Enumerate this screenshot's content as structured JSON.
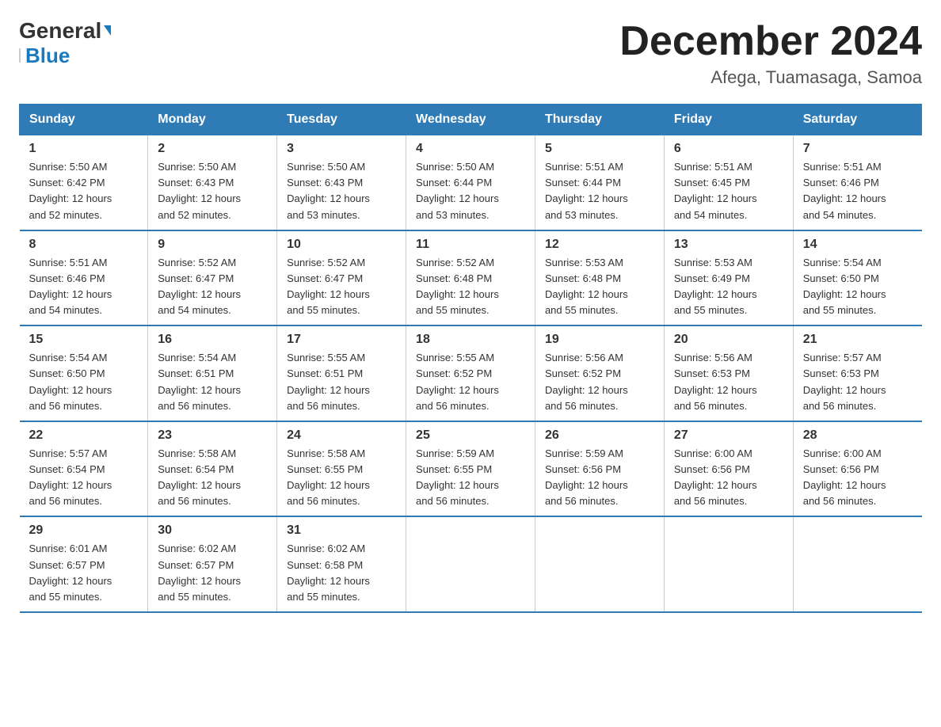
{
  "logo": {
    "brand": "General",
    "accent": "Blue"
  },
  "header": {
    "title": "December 2024",
    "subtitle": "Afega, Tuamasaga, Samoa"
  },
  "days_of_week": [
    "Sunday",
    "Monday",
    "Tuesday",
    "Wednesday",
    "Thursday",
    "Friday",
    "Saturday"
  ],
  "weeks": [
    [
      {
        "day": "1",
        "sunrise": "5:50 AM",
        "sunset": "6:42 PM",
        "daylight": "12 hours and 52 minutes."
      },
      {
        "day": "2",
        "sunrise": "5:50 AM",
        "sunset": "6:43 PM",
        "daylight": "12 hours and 52 minutes."
      },
      {
        "day": "3",
        "sunrise": "5:50 AM",
        "sunset": "6:43 PM",
        "daylight": "12 hours and 53 minutes."
      },
      {
        "day": "4",
        "sunrise": "5:50 AM",
        "sunset": "6:44 PM",
        "daylight": "12 hours and 53 minutes."
      },
      {
        "day": "5",
        "sunrise": "5:51 AM",
        "sunset": "6:44 PM",
        "daylight": "12 hours and 53 minutes."
      },
      {
        "day": "6",
        "sunrise": "5:51 AM",
        "sunset": "6:45 PM",
        "daylight": "12 hours and 54 minutes."
      },
      {
        "day": "7",
        "sunrise": "5:51 AM",
        "sunset": "6:46 PM",
        "daylight": "12 hours and 54 minutes."
      }
    ],
    [
      {
        "day": "8",
        "sunrise": "5:51 AM",
        "sunset": "6:46 PM",
        "daylight": "12 hours and 54 minutes."
      },
      {
        "day": "9",
        "sunrise": "5:52 AM",
        "sunset": "6:47 PM",
        "daylight": "12 hours and 54 minutes."
      },
      {
        "day": "10",
        "sunrise": "5:52 AM",
        "sunset": "6:47 PM",
        "daylight": "12 hours and 55 minutes."
      },
      {
        "day": "11",
        "sunrise": "5:52 AM",
        "sunset": "6:48 PM",
        "daylight": "12 hours and 55 minutes."
      },
      {
        "day": "12",
        "sunrise": "5:53 AM",
        "sunset": "6:48 PM",
        "daylight": "12 hours and 55 minutes."
      },
      {
        "day": "13",
        "sunrise": "5:53 AM",
        "sunset": "6:49 PM",
        "daylight": "12 hours and 55 minutes."
      },
      {
        "day": "14",
        "sunrise": "5:54 AM",
        "sunset": "6:50 PM",
        "daylight": "12 hours and 55 minutes."
      }
    ],
    [
      {
        "day": "15",
        "sunrise": "5:54 AM",
        "sunset": "6:50 PM",
        "daylight": "12 hours and 56 minutes."
      },
      {
        "day": "16",
        "sunrise": "5:54 AM",
        "sunset": "6:51 PM",
        "daylight": "12 hours and 56 minutes."
      },
      {
        "day": "17",
        "sunrise": "5:55 AM",
        "sunset": "6:51 PM",
        "daylight": "12 hours and 56 minutes."
      },
      {
        "day": "18",
        "sunrise": "5:55 AM",
        "sunset": "6:52 PM",
        "daylight": "12 hours and 56 minutes."
      },
      {
        "day": "19",
        "sunrise": "5:56 AM",
        "sunset": "6:52 PM",
        "daylight": "12 hours and 56 minutes."
      },
      {
        "day": "20",
        "sunrise": "5:56 AM",
        "sunset": "6:53 PM",
        "daylight": "12 hours and 56 minutes."
      },
      {
        "day": "21",
        "sunrise": "5:57 AM",
        "sunset": "6:53 PM",
        "daylight": "12 hours and 56 minutes."
      }
    ],
    [
      {
        "day": "22",
        "sunrise": "5:57 AM",
        "sunset": "6:54 PM",
        "daylight": "12 hours and 56 minutes."
      },
      {
        "day": "23",
        "sunrise": "5:58 AM",
        "sunset": "6:54 PM",
        "daylight": "12 hours and 56 minutes."
      },
      {
        "day": "24",
        "sunrise": "5:58 AM",
        "sunset": "6:55 PM",
        "daylight": "12 hours and 56 minutes."
      },
      {
        "day": "25",
        "sunrise": "5:59 AM",
        "sunset": "6:55 PM",
        "daylight": "12 hours and 56 minutes."
      },
      {
        "day": "26",
        "sunrise": "5:59 AM",
        "sunset": "6:56 PM",
        "daylight": "12 hours and 56 minutes."
      },
      {
        "day": "27",
        "sunrise": "6:00 AM",
        "sunset": "6:56 PM",
        "daylight": "12 hours and 56 minutes."
      },
      {
        "day": "28",
        "sunrise": "6:00 AM",
        "sunset": "6:56 PM",
        "daylight": "12 hours and 56 minutes."
      }
    ],
    [
      {
        "day": "29",
        "sunrise": "6:01 AM",
        "sunset": "6:57 PM",
        "daylight": "12 hours and 55 minutes."
      },
      {
        "day": "30",
        "sunrise": "6:02 AM",
        "sunset": "6:57 PM",
        "daylight": "12 hours and 55 minutes."
      },
      {
        "day": "31",
        "sunrise": "6:02 AM",
        "sunset": "6:58 PM",
        "daylight": "12 hours and 55 minutes."
      },
      null,
      null,
      null,
      null
    ]
  ],
  "labels": {
    "sunrise": "Sunrise:",
    "sunset": "Sunset:",
    "daylight": "Daylight:"
  }
}
